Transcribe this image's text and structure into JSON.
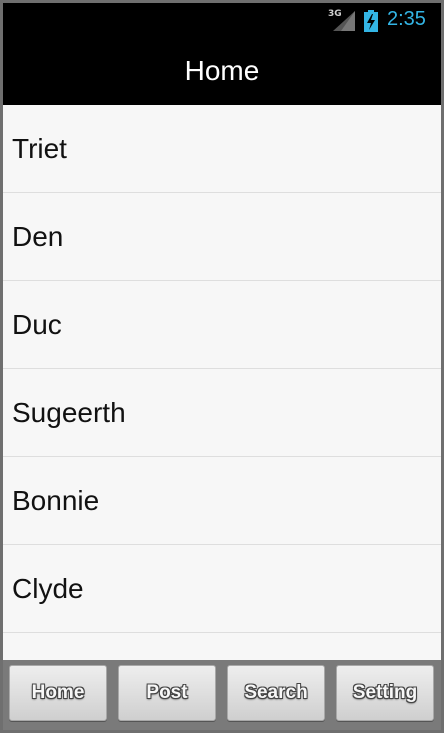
{
  "status_bar": {
    "network": "3G",
    "signal_icon": "signal-icon",
    "battery_icon": "battery-charging-icon",
    "time": "2:35",
    "time_color": "#33b5e5"
  },
  "title_bar": {
    "title": "Home"
  },
  "list": {
    "items": [
      {
        "label": "Triet"
      },
      {
        "label": "Den"
      },
      {
        "label": "Duc"
      },
      {
        "label": "Sugeerth"
      },
      {
        "label": "Bonnie"
      },
      {
        "label": "Clyde"
      }
    ]
  },
  "bottom_bar": {
    "buttons": [
      {
        "label": "Home"
      },
      {
        "label": "Post"
      },
      {
        "label": "Search"
      },
      {
        "label": "Setting"
      }
    ]
  }
}
